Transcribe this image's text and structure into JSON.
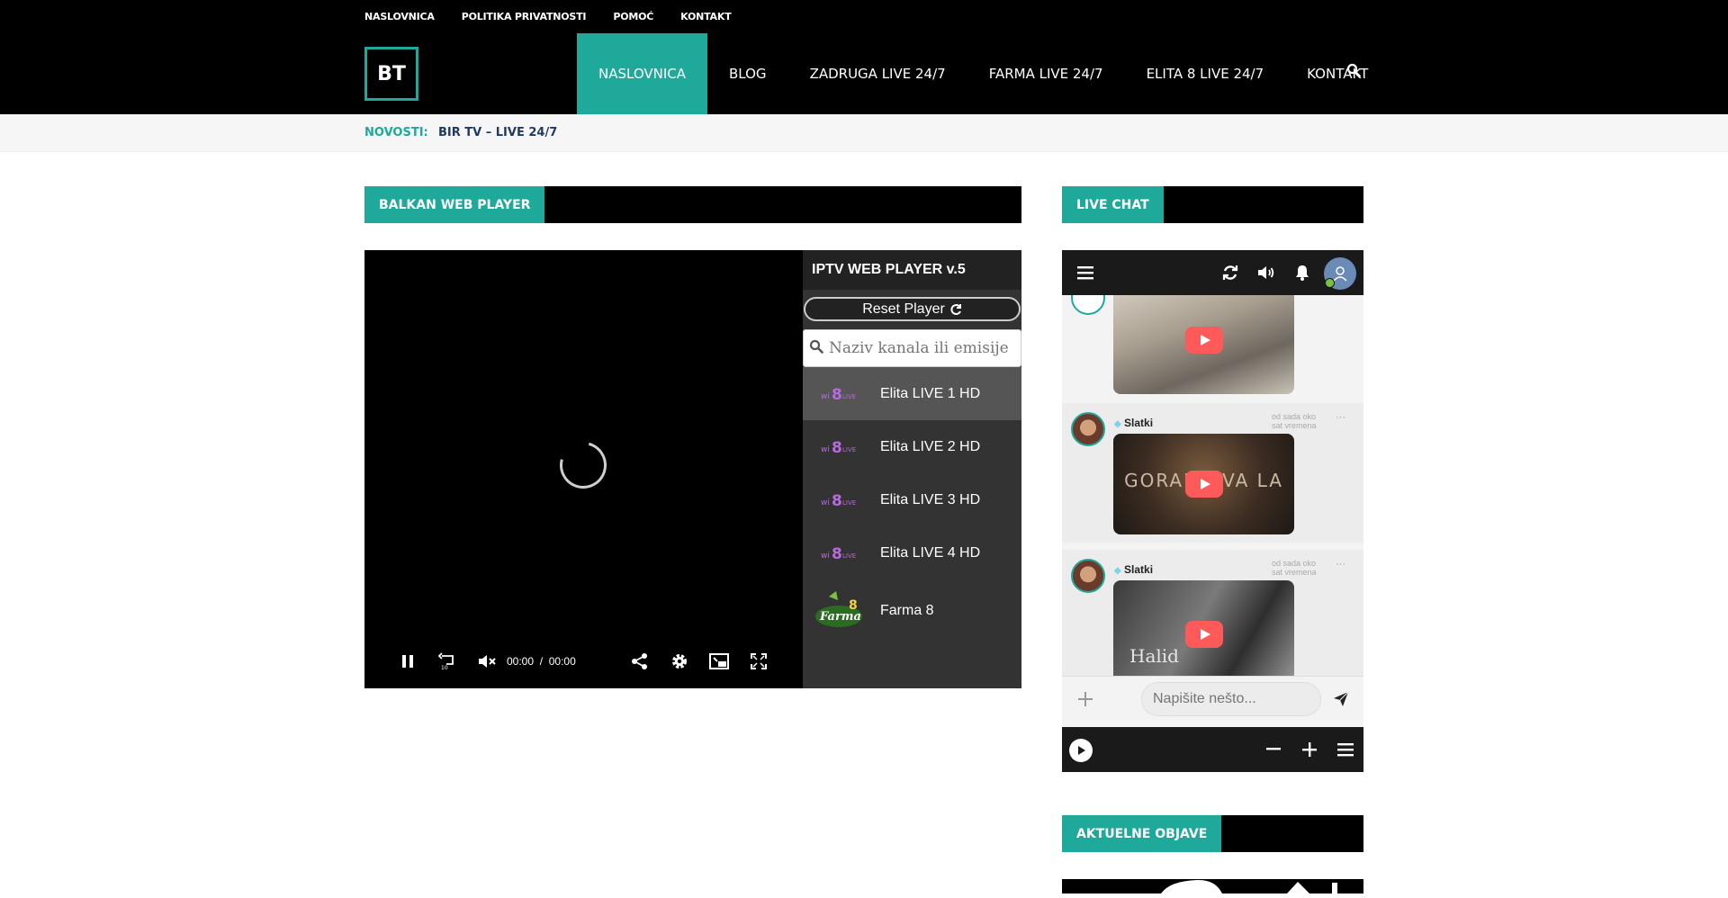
{
  "top_links": [
    "NASLOVNICA",
    "POLITIKA PRIVATNOSTI",
    "POMOĆ",
    "KONTAKT"
  ],
  "logo_text": "BT",
  "main_nav": [
    "NASLOVNICA",
    "BLOG",
    "ZADRUGA LIVE 24/7",
    "FARMA LIVE 24/7",
    "ELITA 8 LIVE 24/7",
    "KONTAKT"
  ],
  "news": {
    "label": "NOVOSTI:",
    "item": "BIR TV – LIVE 24/7"
  },
  "sections": {
    "player": "BALKAN WEB PLAYER",
    "chat": "LIVE CHAT",
    "recent": "AKTUELNE OBJAVE"
  },
  "player": {
    "title": "IPTV WEB PLAYER v.5",
    "reset_label": "Reset Player",
    "search_placeholder": "Naziv kanala ili emisije....",
    "time_current": "00:00",
    "time_separator": "/",
    "time_total": "00:00",
    "channels": [
      {
        "name": "Elita LIVE 1 HD",
        "active": true
      },
      {
        "name": "Elita LIVE 2 HD",
        "active": false
      },
      {
        "name": "Elita LIVE 3 HD",
        "active": false
      },
      {
        "name": "Elita LIVE 4 HD",
        "active": false
      },
      {
        "name": "Farma 8",
        "active": false
      }
    ]
  },
  "chat": {
    "messages": [
      {
        "user": "Slatki",
        "time": "od sada oko sat vremena",
        "thumb_text": "GORANO VA LA"
      },
      {
        "user": "Slatki",
        "time": "od sada oko sat vremena",
        "thumb_text": "Halid"
      }
    ],
    "input_placeholder": "Napišite nešto..."
  },
  "colors": {
    "accent": "#1fa99a",
    "header_bg": "#000000",
    "news_link": "#1e3a5f"
  }
}
